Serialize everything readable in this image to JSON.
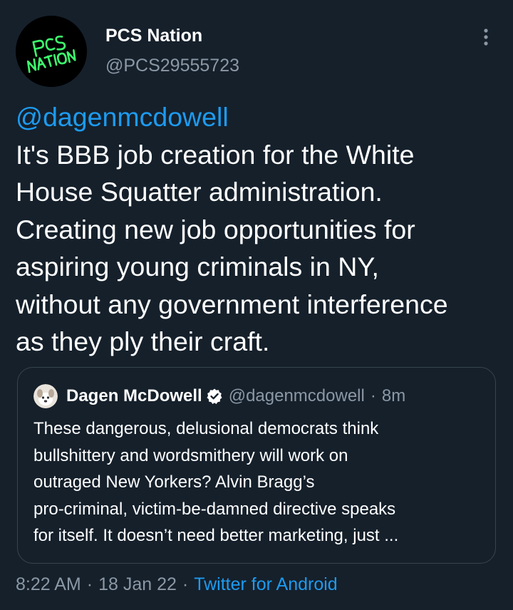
{
  "author": {
    "display_name": "PCS Nation",
    "handle": "@PCS29555723",
    "avatar_text_line1": "PCS",
    "avatar_text_line2": "NATION"
  },
  "tweet": {
    "mention": "@dagenmcdowell",
    "text": "It's BBB job creation for the White\nHouse Squatter administration.\nCreating new job opportunities for\naspiring young criminals in NY,\nwithout any government interference\nas they ply their craft."
  },
  "quote": {
    "display_name": "Dagen McDowell",
    "handle": "@dagenmcdowell",
    "dot": "·",
    "time": "8m",
    "text": "These dangerous, delusional democrats think\nbullshittery and wordsmithery will work on\noutraged New Yorkers? Alvin Bragg’s\npro-criminal, victim-be-damned directive speaks\nfor itself. It doesn’t need better marketing, just ..."
  },
  "meta": {
    "time": "8:22 AM",
    "sep1": "·",
    "date": "18 Jan 22",
    "sep2": "·",
    "source": "Twitter for Android"
  },
  "colors": {
    "background": "#15202b",
    "link": "#1d9bf0",
    "secondary_text": "#8b98a5",
    "avatar_text": "#3dff6e"
  },
  "icons": {
    "more": "more-vertical-icon",
    "verified": "verified-badge-icon"
  }
}
